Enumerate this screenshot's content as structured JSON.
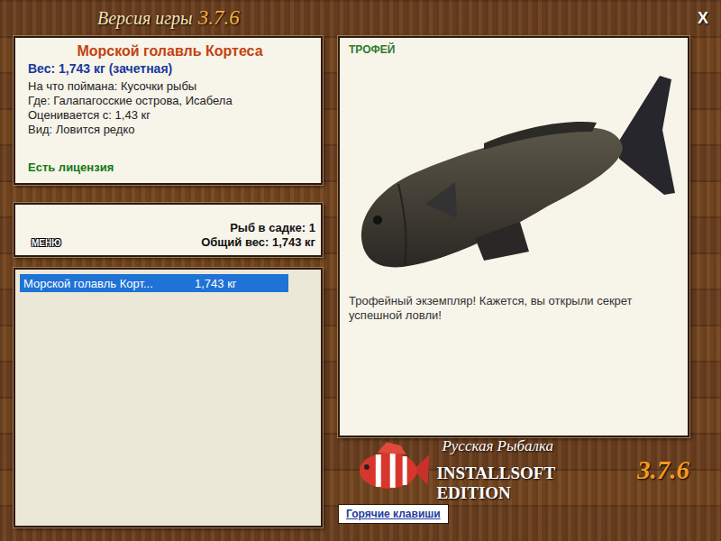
{
  "header": {
    "title": "Версия игры",
    "version": "3.7.6",
    "close": "X"
  },
  "fish_card": {
    "name": "Морской голавль Кортеса",
    "weight": "Вес: 1,743 кг (зачетная)",
    "details": [
      "На что поймана: Кусочки рыбы",
      "Где: Галапагосские острова, Исабела",
      "Оценивается с: 1,43 кг",
      "Вид: Ловится редко"
    ],
    "license": "Есть лицензия"
  },
  "keepnet": {
    "menu": "МЕНЮ",
    "count": "Рыб в садке: 1",
    "total": "Общий вес: 1,743 кг"
  },
  "catch_list": [
    {
      "name": "Морской голавль Корт...",
      "weight": "1,743 кг",
      "selected": true
    }
  ],
  "trophy": {
    "badge": "ТРОФЕЙ",
    "message": "Трофейный экземпляр! Кажется, вы открыли секрет успешной ловли!"
  },
  "branding": {
    "title": "Русская Рыбалка",
    "edition": "INSTALLSOFT EDITION",
    "version": "3.7.6"
  },
  "hotkeys": "Горячие клавиши"
}
